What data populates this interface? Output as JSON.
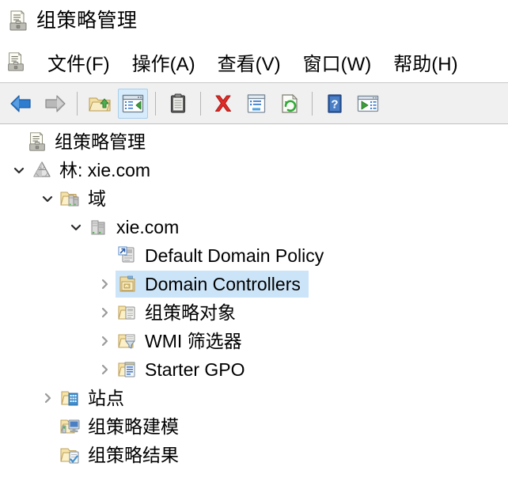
{
  "window": {
    "title": "组策略管理",
    "title_icon": "group-policy-management-icon"
  },
  "menu": {
    "system_icon": "group-policy-management-icon",
    "items": [
      {
        "label": "文件(F)",
        "name": "menu-file"
      },
      {
        "label": "操作(A)",
        "name": "menu-action"
      },
      {
        "label": "查看(V)",
        "name": "menu-view"
      },
      {
        "label": "窗口(W)",
        "name": "menu-window"
      },
      {
        "label": "帮助(H)",
        "name": "menu-help"
      }
    ]
  },
  "toolbar": {
    "buttons": [
      {
        "name": "back-button",
        "icon": "back-arrow-icon",
        "enabled": true
      },
      {
        "name": "forward-button",
        "icon": "forward-arrow-icon",
        "enabled": false
      },
      {
        "name": "up-one-level-button",
        "icon": "folder-up-icon",
        "enabled": true
      },
      {
        "name": "show-console-tree-button",
        "icon": "console-tree-icon",
        "active": true
      },
      {
        "name": "properties-clipboard-button",
        "icon": "clipboard-icon",
        "enabled": true
      },
      {
        "name": "delete-button",
        "icon": "red-x-icon",
        "enabled": true
      },
      {
        "name": "properties-button",
        "icon": "properties-window-icon",
        "enabled": true
      },
      {
        "name": "refresh-button",
        "icon": "refresh-green-icon",
        "enabled": true
      },
      {
        "name": "help-button",
        "icon": "blue-question-icon",
        "enabled": true
      },
      {
        "name": "export-list-button",
        "icon": "export-list-icon",
        "enabled": true
      }
    ]
  },
  "tree": {
    "nodes": [
      {
        "label": "组策略管理",
        "name": "tree-node-group-policy-management",
        "icon": "group-policy-management-icon",
        "indent": "indent-0",
        "expander": "none",
        "selected": false
      },
      {
        "label": "林: xie.com",
        "name": "tree-node-forest",
        "icon": "forest-icon",
        "indent": "indent-1",
        "expander": "expanded",
        "selected": false
      },
      {
        "label": "域",
        "name": "tree-node-domains",
        "icon": "domains-folder-icon",
        "indent": "indent-2",
        "expander": "expanded",
        "selected": false
      },
      {
        "label": "xie.com",
        "name": "tree-node-domain-xie-com",
        "icon": "domain-server-icon",
        "indent": "indent-3",
        "expander": "expanded",
        "selected": false
      },
      {
        "label": "Default Domain Policy",
        "name": "tree-node-default-domain-policy",
        "icon": "gpo-link-icon",
        "indent": "indent-4b",
        "expander": "none",
        "selected": false
      },
      {
        "label": "Domain Controllers",
        "name": "tree-node-domain-controllers",
        "icon": "ou-folder-icon",
        "indent": "indent-4",
        "expander": "collapsed",
        "selected": true
      },
      {
        "label": "组策略对象",
        "name": "tree-node-group-policy-objects",
        "icon": "gpo-folder-icon",
        "indent": "indent-4",
        "expander": "collapsed",
        "selected": false
      },
      {
        "label": "WMI 筛选器",
        "name": "tree-node-wmi-filters",
        "icon": "wmi-filter-folder-icon",
        "indent": "indent-4",
        "expander": "collapsed",
        "selected": false
      },
      {
        "label": "Starter GPO",
        "name": "tree-node-starter-gpo",
        "icon": "starter-gpo-folder-icon",
        "indent": "indent-4",
        "expander": "collapsed",
        "selected": false
      },
      {
        "label": "站点",
        "name": "tree-node-sites",
        "icon": "sites-folder-icon",
        "indent": "indent-2",
        "expander": "collapsed",
        "selected": false
      },
      {
        "label": "组策略建模",
        "name": "tree-node-gp-modeling",
        "icon": "gp-modeling-folder-icon",
        "indent": "indent-2",
        "expander": "none",
        "selected": false
      },
      {
        "label": "组策略结果",
        "name": "tree-node-gp-results",
        "icon": "gp-results-folder-icon",
        "indent": "indent-2",
        "expander": "none",
        "selected": false
      }
    ]
  },
  "colors": {
    "selection": "#cce4f7",
    "toolbar_bg": "#f0f0f0",
    "active_button_bg": "#d6ebfb",
    "folder": "#f5dea0",
    "accent_blue": "#2a6ebb"
  }
}
